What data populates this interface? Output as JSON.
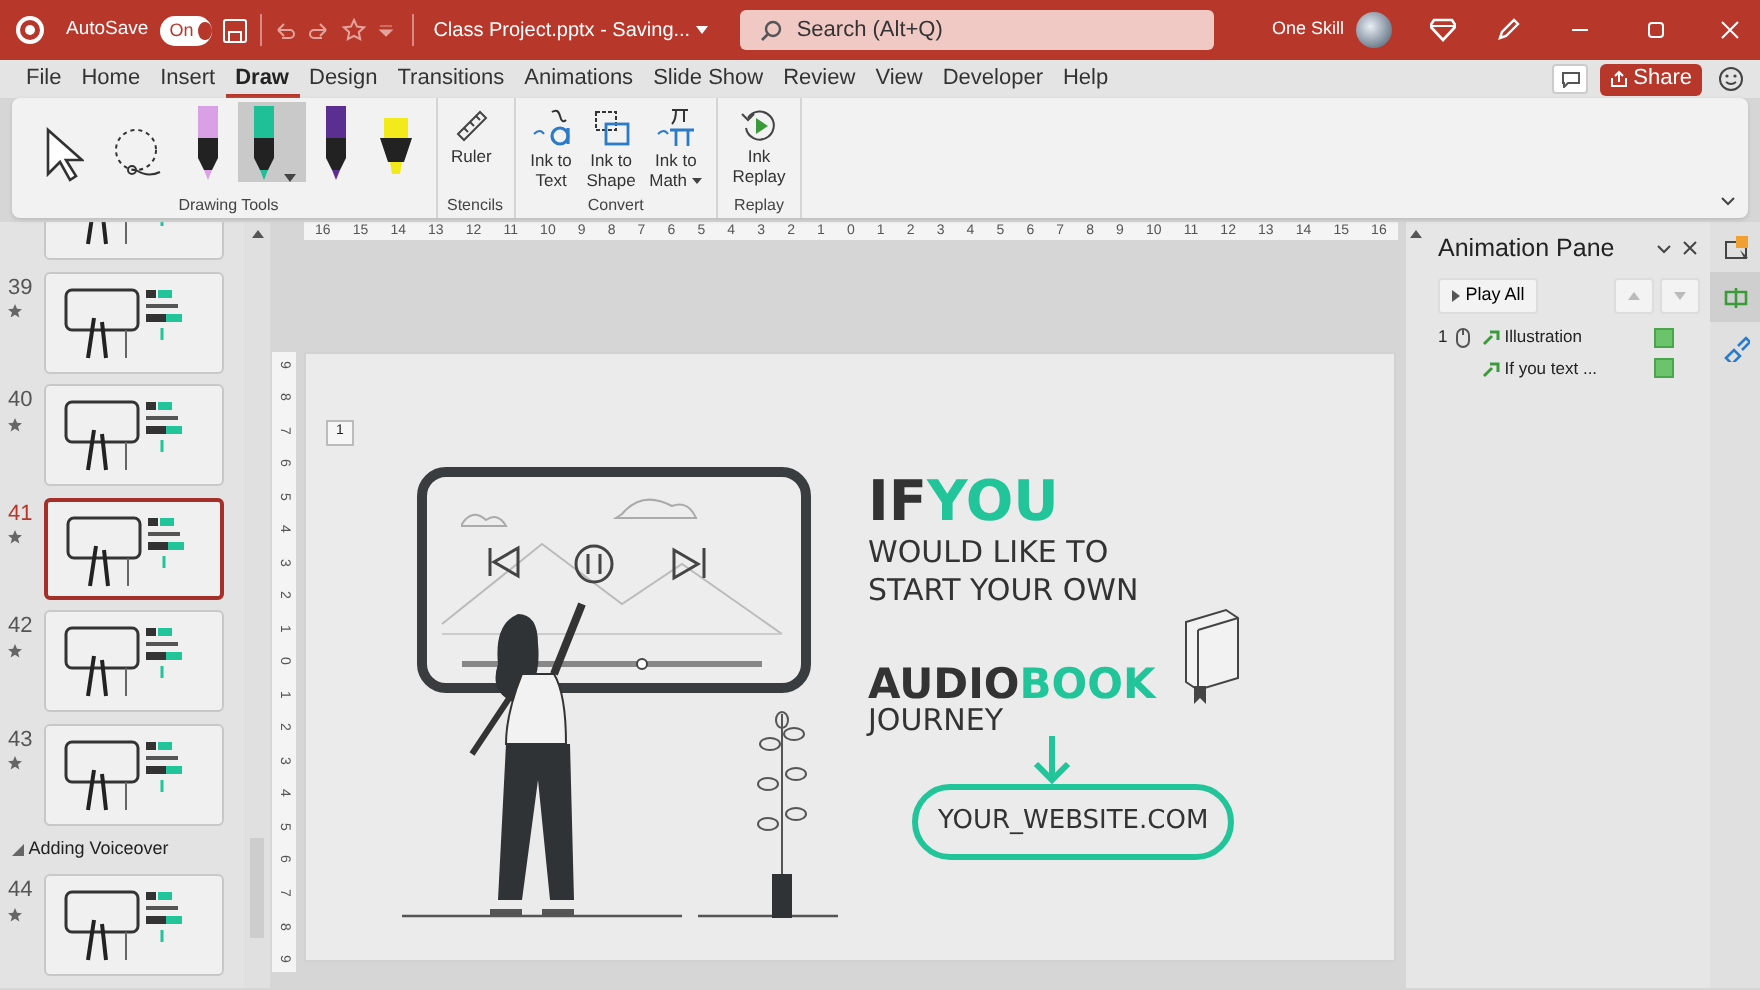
{
  "title_bar": {
    "autosave_label": "AutoSave",
    "autosave_on": true,
    "autosave_state": "On",
    "document_title": "Class Project.pptx - Saving...",
    "search_placeholder": "Search (Alt+Q)",
    "user_name": "One Skill"
  },
  "menu_tabs": [
    {
      "label": "File",
      "selected": false
    },
    {
      "label": "Home",
      "selected": false
    },
    {
      "label": "Insert",
      "selected": false
    },
    {
      "label": "Draw",
      "selected": true
    },
    {
      "label": "Design",
      "selected": false
    },
    {
      "label": "Transitions",
      "selected": false
    },
    {
      "label": "Animations",
      "selected": false
    },
    {
      "label": "Slide Show",
      "selected": false
    },
    {
      "label": "Review",
      "selected": false
    },
    {
      "label": "View",
      "selected": false
    },
    {
      "label": "Developer",
      "selected": false
    },
    {
      "label": "Help",
      "selected": false
    }
  ],
  "share_label": "Share",
  "ribbon_groups": [
    {
      "label": "Drawing Tools",
      "tools": [
        {
          "kind": "pointer",
          "selected": false
        },
        {
          "kind": "lasso",
          "selected": false
        },
        {
          "kind": "pen",
          "color": "#d9a0e6",
          "selected": false
        },
        {
          "kind": "pen",
          "color": "#1fbf98",
          "selected": true
        },
        {
          "kind": "pen",
          "color": "#5b2e91",
          "selected": false
        },
        {
          "kind": "highlighter",
          "color": "#f3ea1c",
          "selected": false
        }
      ]
    },
    {
      "label": "Stencils",
      "tools": [
        {
          "kind": "ruler",
          "label_lines": [
            "Ruler"
          ],
          "dropdown": false
        }
      ]
    },
    {
      "label": "Convert",
      "tools": [
        {
          "kind": "ink-to-text",
          "label_lines": [
            "Ink to",
            "Text"
          ],
          "dropdown": false
        },
        {
          "kind": "ink-to-shape",
          "label_lines": [
            "Ink to",
            "Shape"
          ],
          "dropdown": false
        },
        {
          "kind": "ink-to-math",
          "label_lines": [
            "Ink to",
            "Math"
          ],
          "dropdown": true
        }
      ]
    },
    {
      "label": "Replay",
      "tools": [
        {
          "kind": "replay",
          "label_lines": [
            "Ink",
            "Replay"
          ],
          "dropdown": false
        }
      ]
    }
  ],
  "slide_list": [
    {
      "kind": "partial-slide"
    },
    {
      "kind": "slide",
      "number": "39",
      "selected": false
    },
    {
      "kind": "slide",
      "number": "40",
      "selected": false
    },
    {
      "kind": "slide",
      "number": "41",
      "selected": true
    },
    {
      "kind": "slide",
      "number": "42",
      "selected": false
    },
    {
      "kind": "slide",
      "number": "43",
      "selected": false
    },
    {
      "kind": "section",
      "label": "Adding Voiceover",
      "expanded": true
    },
    {
      "kind": "slide",
      "number": "44",
      "selected": false
    }
  ],
  "horizontal_ruler": [
    "16",
    "15",
    "14",
    "13",
    "12",
    "11",
    "10",
    "9",
    "8",
    "7",
    "6",
    "5",
    "4",
    "3",
    "2",
    "1",
    "0",
    "1",
    "2",
    "3",
    "4",
    "5",
    "6",
    "7",
    "8",
    "9",
    "10",
    "11",
    "12",
    "13",
    "14",
    "15",
    "16"
  ],
  "vertical_ruler": [
    "9",
    "8",
    "7",
    "6",
    "5",
    "4",
    "3",
    "2",
    "1",
    "0",
    "1",
    "2",
    "3",
    "4",
    "5",
    "6",
    "7",
    "8",
    "9"
  ],
  "slide": {
    "animation_tag": "1",
    "heading": [
      {
        "text": "IF",
        "accent": false
      },
      {
        "text": "YOU",
        "accent": true
      }
    ],
    "lines": [
      "WOULD LIKE TO",
      "START YOUR OWN"
    ],
    "audiobook": [
      {
        "text": "AUDIO",
        "accent": false
      },
      {
        "text": "BOOK",
        "accent": true
      }
    ],
    "last_line": "JOURNEY",
    "website": "YOUR_WEBSITE.COM"
  },
  "animation_pane": {
    "title": "Animation Pane",
    "play_all": "Play All",
    "items": [
      {
        "order": "1",
        "on_click": true,
        "name": "Illustration"
      },
      {
        "on_click": false,
        "name": "If you text ..."
      }
    ]
  },
  "right_rail": [
    {
      "kind": "selection",
      "selected": false
    },
    {
      "kind": "animation",
      "selected": true
    },
    {
      "kind": "format",
      "selected": false
    }
  ]
}
